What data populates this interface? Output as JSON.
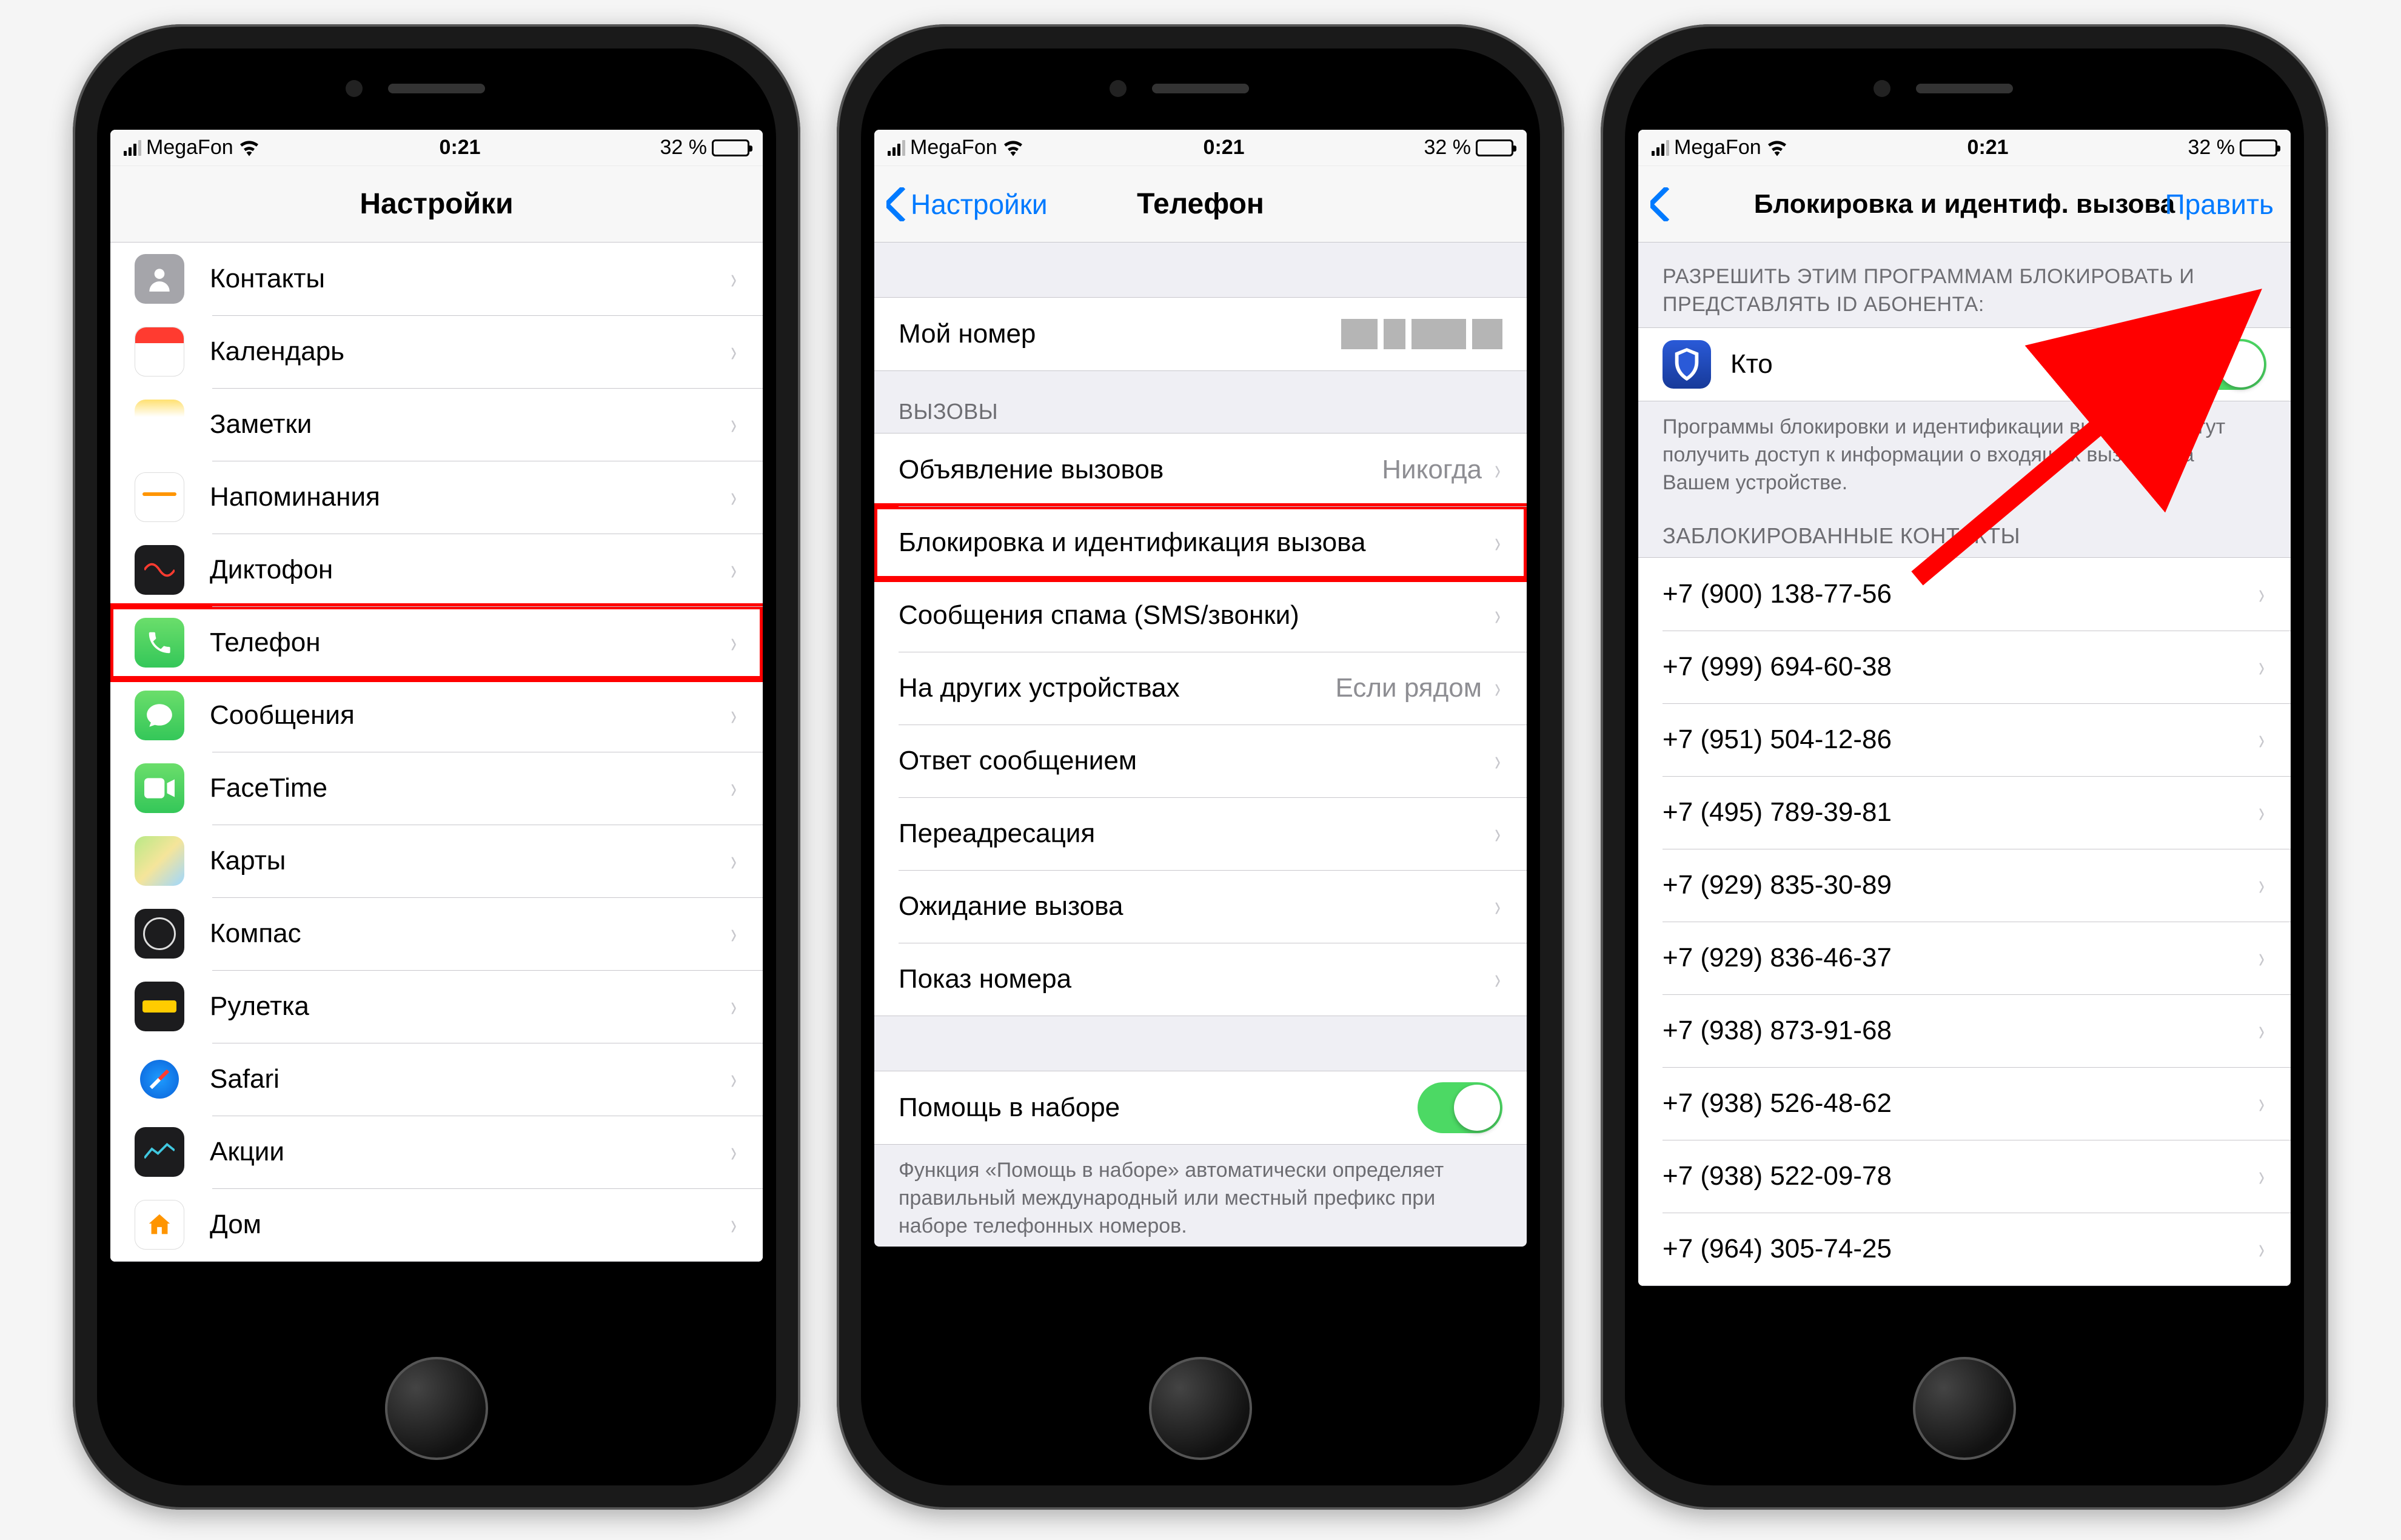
{
  "status": {
    "carrier": "MegaFon",
    "time": "0:21",
    "battery_pct": "32 %"
  },
  "screen1": {
    "title": "Настройки",
    "items": [
      {
        "id": "contacts",
        "label": "Контакты"
      },
      {
        "id": "calendar",
        "label": "Календарь"
      },
      {
        "id": "notes",
        "label": "Заметки"
      },
      {
        "id": "reminders",
        "label": "Напоминания"
      },
      {
        "id": "voicememos",
        "label": "Диктофон"
      },
      {
        "id": "phone",
        "label": "Телефон",
        "highlight": true
      },
      {
        "id": "messages",
        "label": "Сообщения"
      },
      {
        "id": "facetime",
        "label": "FaceTime"
      },
      {
        "id": "maps",
        "label": "Карты"
      },
      {
        "id": "compass",
        "label": "Компас"
      },
      {
        "id": "measure",
        "label": "Рулетка"
      },
      {
        "id": "safari",
        "label": "Safari"
      },
      {
        "id": "stocks",
        "label": "Акции"
      },
      {
        "id": "home",
        "label": "Дом"
      }
    ]
  },
  "screen2": {
    "back": "Настройки",
    "title": "Телефон",
    "myNumberLabel": "Мой номер",
    "callsHeader": "ВЫЗОВЫ",
    "calls": [
      {
        "id": "announce",
        "label": "Объявление вызовов",
        "detail": "Никогда"
      },
      {
        "id": "block",
        "label": "Блокировка и идентификация вызова",
        "highlight": true
      },
      {
        "id": "spam",
        "label": "Сообщения спама (SMS/звонки)"
      },
      {
        "id": "other",
        "label": "На других устройствах",
        "detail": "Если рядом"
      },
      {
        "id": "respond",
        "label": "Ответ сообщением"
      },
      {
        "id": "forward",
        "label": "Переадресация"
      },
      {
        "id": "waiting",
        "label": "Ожидание вызова"
      },
      {
        "id": "callerid",
        "label": "Показ номера"
      }
    ],
    "dialAssistLabel": "Помощь в наборе",
    "dialAssistFooter": "Функция «Помощь в наборе» автоматически определяет правильный международный или местный префикс при наборе телефонных номеров."
  },
  "screen3": {
    "title": "Блокировка и идентиф. вызова",
    "edit": "Править",
    "appsHeader": "РАЗРЕШИТЬ ЭТИМ ПРОГРАММАМ БЛОКИРОВАТЬ И ПРЕДСТАВЛЯТЬ ID АБОНЕНТА:",
    "app": {
      "label": "Кто",
      "enabled": true
    },
    "appsFooter": "Программы блокировки и идентификации вызова не могут получить доступ к информации о входящих вызовах на Вашем устройстве.",
    "blockedHeader": "ЗАБЛОКИРОВАННЫЕ КОНТАКТЫ",
    "blocked": [
      "+7 (900) 138-77-56",
      "+7 (999) 694-60-38",
      "+7 (951) 504-12-86",
      "+7 (495) 789-39-81",
      "+7 (929) 835-30-89",
      "+7 (929) 836-46-37",
      "+7 (938) 873-91-68",
      "+7 (938) 526-48-62",
      "+7 (938) 522-09-78",
      "+7 (964) 305-74-25"
    ]
  }
}
